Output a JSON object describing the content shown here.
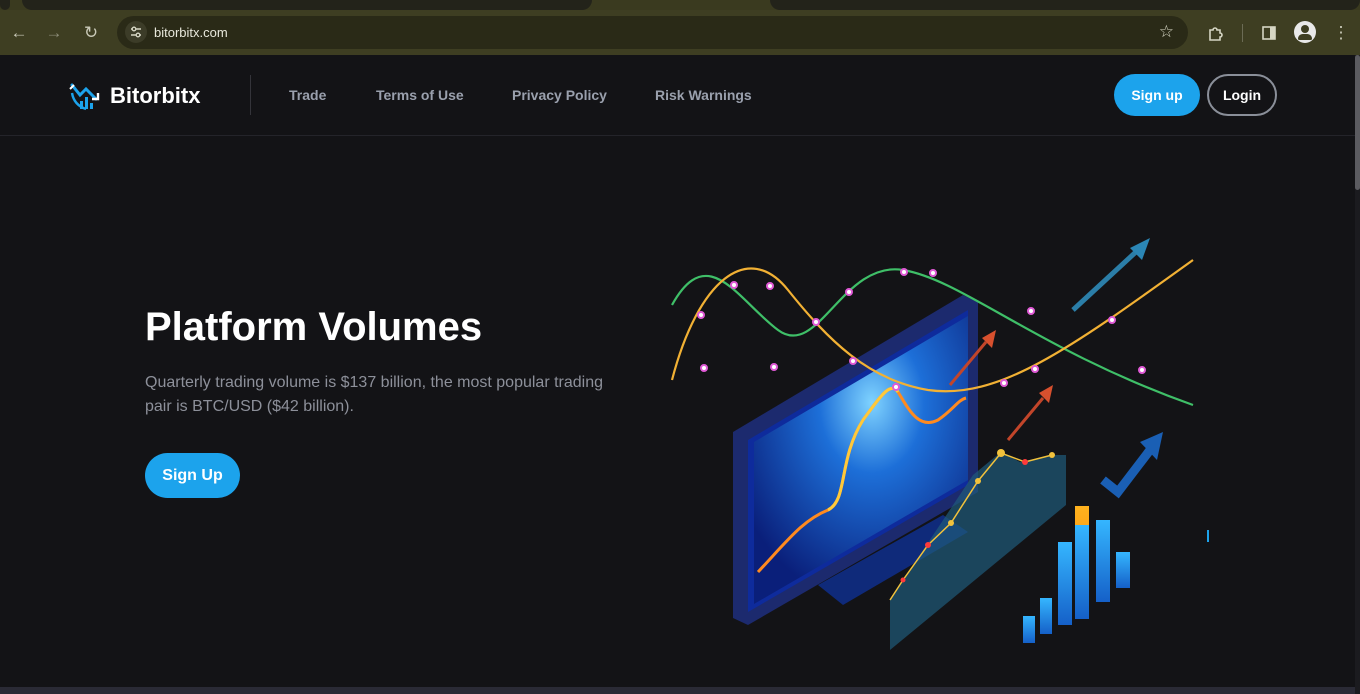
{
  "browser": {
    "url": "bitorbitx.com",
    "icons": [
      "back-arrow-icon",
      "forward-arrow-icon",
      "reload-icon",
      "site-settings-icon",
      "star-icon",
      "extensions-icon",
      "side-panel-icon",
      "profile-icon",
      "menu-dots-icon"
    ]
  },
  "site": {
    "brand": "Bitorbitx",
    "nav": {
      "trade": "Trade",
      "terms": "Terms of Use",
      "privacy": "Privacy Policy",
      "risk": "Risk Warnings"
    },
    "signup_label": "Sign up",
    "login_label": "Login"
  },
  "hero": {
    "title": "Platform Volumes",
    "description": "Quarterly trading volume is $137 billion, the most popular trading pair is BTC/USD ($42 billion).",
    "cta_label": "Sign Up"
  },
  "colors": {
    "accent": "#1ca3ec",
    "background": "#131316",
    "chrome": "#3e3e22"
  }
}
